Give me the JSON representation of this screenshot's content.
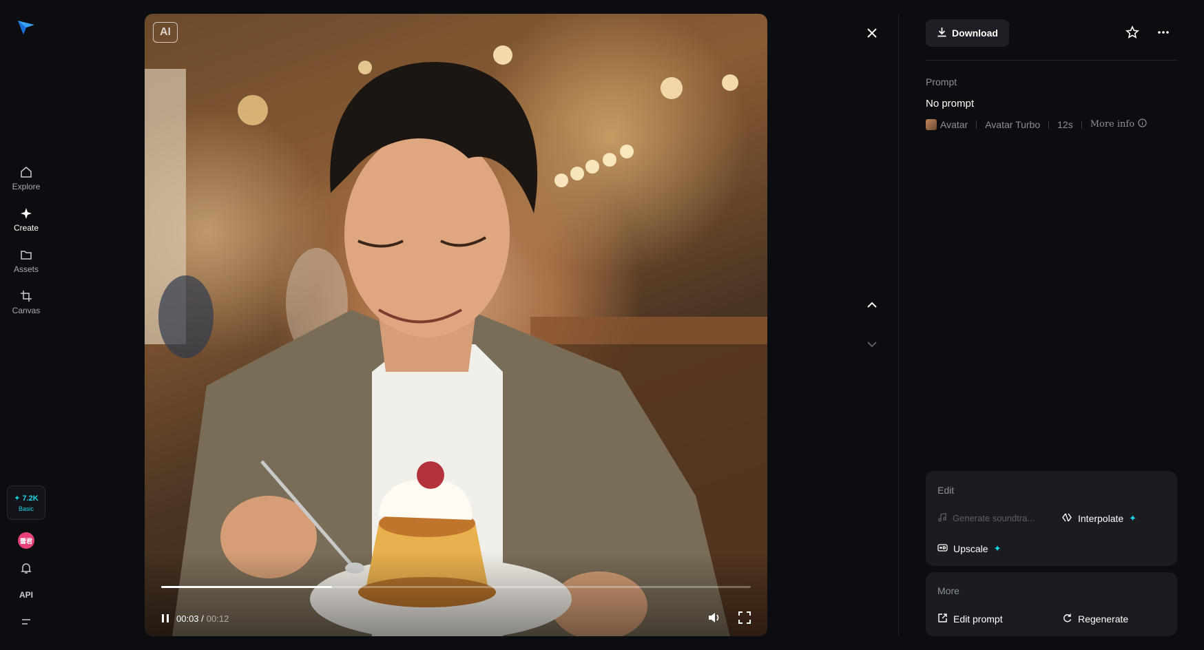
{
  "sidebar": {
    "items": [
      {
        "label": "Explore",
        "icon": "home-icon"
      },
      {
        "label": "Create",
        "icon": "sparkle-icon"
      },
      {
        "label": "Assets",
        "icon": "folder-icon"
      },
      {
        "label": "Canvas",
        "icon": "crop-icon"
      }
    ],
    "credits": {
      "amount": "✦ 7.2K",
      "plan": "Basic"
    },
    "user_initials": "蕾君",
    "api_label": "API"
  },
  "media": {
    "badge": "AI",
    "current_time": "00:03 /",
    "total_time": "00:12",
    "progress_fraction": 0.29
  },
  "panel": {
    "download_label": "Download",
    "prompt_label": "Prompt",
    "prompt_value": "No prompt",
    "meta": {
      "type": "Avatar",
      "model": "Avatar Turbo",
      "duration": "12s",
      "more_info": "More info"
    },
    "edit": {
      "title": "Edit",
      "soundtrack": "Generate soundtra...",
      "interpolate": "Interpolate",
      "upscale": "Upscale"
    },
    "more": {
      "title": "More",
      "edit_prompt": "Edit prompt",
      "regenerate": "Regenerate"
    }
  },
  "colors": {
    "accent": "#1fd6e8",
    "background": "#0c0d10",
    "card": "#1a1c21"
  }
}
